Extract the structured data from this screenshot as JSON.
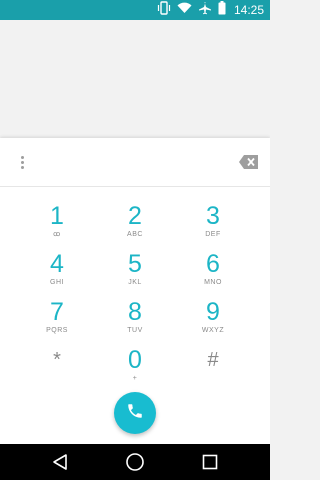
{
  "status_bar": {
    "time": "14:25",
    "icons": [
      "vibrate-icon",
      "wifi-icon",
      "airplane-icon",
      "battery-icon"
    ],
    "background": "#1a9faa"
  },
  "dialpad": {
    "keys": [
      {
        "digit": "1",
        "letters": "ꝏ"
      },
      {
        "digit": "2",
        "letters": "ABC"
      },
      {
        "digit": "3",
        "letters": "DEF"
      },
      {
        "digit": "4",
        "letters": "GHI"
      },
      {
        "digit": "5",
        "letters": "JKL"
      },
      {
        "digit": "6",
        "letters": "MNO"
      },
      {
        "digit": "7",
        "letters": "PQRS"
      },
      {
        "digit": "8",
        "letters": "TUV"
      },
      {
        "digit": "9",
        "letters": "WXYZ"
      },
      {
        "digit": "*",
        "letters": ""
      },
      {
        "digit": "0",
        "letters": "+"
      },
      {
        "digit": "#",
        "letters": ""
      }
    ],
    "accent": "#1cb5c6",
    "call_button_color": "#18bcd0"
  },
  "icons": {
    "overflow": "overflow-menu-icon",
    "backspace": "backspace-icon",
    "call": "phone-icon",
    "nav_back": "back-icon",
    "nav_home": "home-icon",
    "nav_recents": "recents-icon"
  }
}
